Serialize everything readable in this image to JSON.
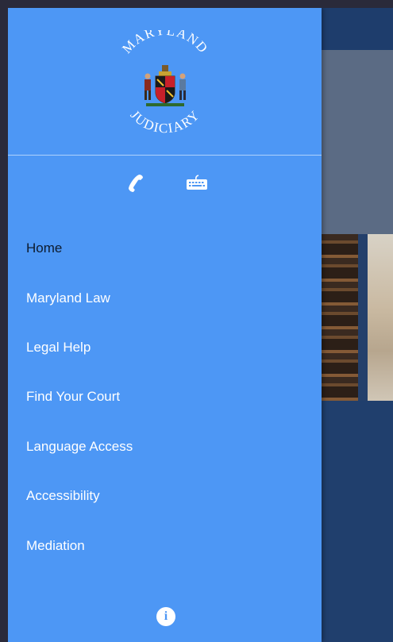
{
  "header": {
    "seal_top_text": "MARYLAND",
    "seal_bottom_text": "JUDICIARY"
  },
  "contact_icons": {
    "phone": "phone-icon",
    "keyboard": "keyboard-icon"
  },
  "menu": {
    "items": [
      {
        "label": "Home",
        "active": true
      },
      {
        "label": "Maryland Law",
        "active": false
      },
      {
        "label": "Legal Help",
        "active": false
      },
      {
        "label": "Find Your Court",
        "active": false
      },
      {
        "label": "Language Access",
        "active": false
      },
      {
        "label": "Accessibility",
        "active": false
      },
      {
        "label": "Mediation",
        "active": false
      }
    ]
  },
  "footer": {
    "info_icon": "info-icon",
    "info_glyph": "i"
  },
  "colors": {
    "drawer_bg": "#4d97f5",
    "active_text": "#0d1b2e",
    "inactive_text": "#ffffff",
    "app_bar": "#1e3d6c"
  }
}
